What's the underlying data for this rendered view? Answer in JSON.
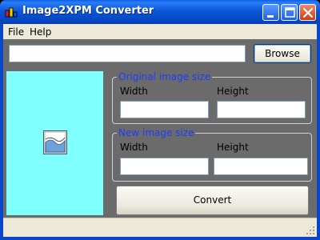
{
  "window": {
    "title": "Image2XPM Converter"
  },
  "titlebar": {
    "icons": [
      "app-icon",
      "minimize-icon",
      "maximize-icon",
      "close-icon"
    ]
  },
  "menu": {
    "file": "File",
    "help": "Help"
  },
  "file_input": {
    "value": "",
    "placeholder": ""
  },
  "browse_label": "Browse",
  "preview": {
    "background": "#80ffff",
    "icon": "broken-image-icon"
  },
  "original_size": {
    "legend": "Original image size",
    "width_label": "Width",
    "height_label": "Height",
    "width_value": "",
    "height_value": ""
  },
  "new_size": {
    "legend": "New image size",
    "width_label": "Width",
    "height_label": "Height",
    "width_value": "",
    "height_value": ""
  },
  "convert_label": "Convert",
  "colors": {
    "titlebar": "#0a5fe8",
    "legend_text": "#1e3cff",
    "client_bg": "#6b6b6b"
  }
}
